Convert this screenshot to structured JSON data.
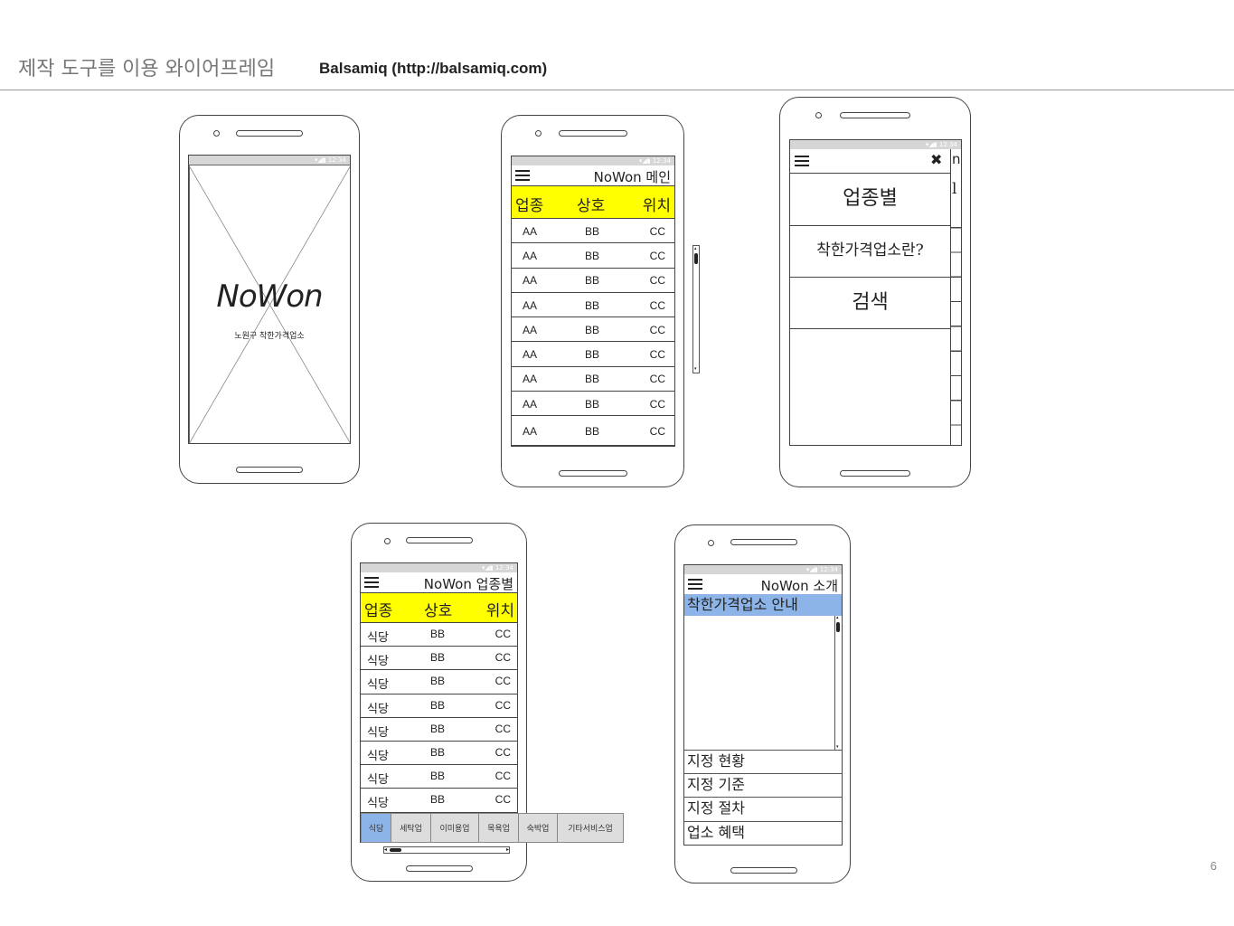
{
  "slide": {
    "title": "제작 도구를 이용 와이어프레임",
    "subtitle": "Balsamiq (http://balsamiq.com)",
    "page_number": "6"
  },
  "status_icons": "▾◢▮ 12:34",
  "splash": {
    "logo": "NoWon",
    "tagline": "노원구 착한가격업소"
  },
  "main_screen": {
    "title": "NoWon 메인",
    "headers": [
      "업종",
      "상호",
      "위치"
    ],
    "rows": [
      [
        "AA",
        "BB",
        "CC"
      ],
      [
        "AA",
        "BB",
        "CC"
      ],
      [
        "AA",
        "BB",
        "CC"
      ],
      [
        "AA",
        "BB",
        "CC"
      ],
      [
        "AA",
        "BB",
        "CC"
      ],
      [
        "AA",
        "BB",
        "CC"
      ],
      [
        "AA",
        "BB",
        "CC"
      ],
      [
        "AA",
        "BB",
        "CC"
      ],
      [
        "AA",
        "BB",
        "CC"
      ]
    ]
  },
  "menu_screen": {
    "close": "✖",
    "under_title_fragment": "n",
    "under_header_fragment": "l",
    "items": [
      "업종별",
      "착한가격업소란?",
      "검색"
    ]
  },
  "category_screen": {
    "title": "NoWon 업종별",
    "headers": [
      "업종",
      "상호",
      "위치"
    ],
    "rows": [
      [
        "식당",
        "BB",
        "CC"
      ],
      [
        "식당",
        "BB",
        "CC"
      ],
      [
        "식당",
        "BB",
        "CC"
      ],
      [
        "식당",
        "BB",
        "CC"
      ],
      [
        "식당",
        "BB",
        "CC"
      ],
      [
        "식당",
        "BB",
        "CC"
      ],
      [
        "식당",
        "BB",
        "CC"
      ],
      [
        "식당",
        "BB",
        "CC"
      ]
    ],
    "tabs": [
      "식당",
      "세탁업",
      "이미용업",
      "목욕업",
      "숙박업",
      "기타서비스업"
    ],
    "active_tab": 0
  },
  "intro_screen": {
    "title": "NoWon 소개",
    "section_header": "착한가격업소 안내",
    "list": [
      "지정 현황",
      "지정 기준",
      "지정 절차",
      "업소 혜택"
    ]
  },
  "colors": {
    "header_yellow": "#ffff00",
    "active_blue": "#8db4e8",
    "status_gray": "#d6d6d6"
  }
}
